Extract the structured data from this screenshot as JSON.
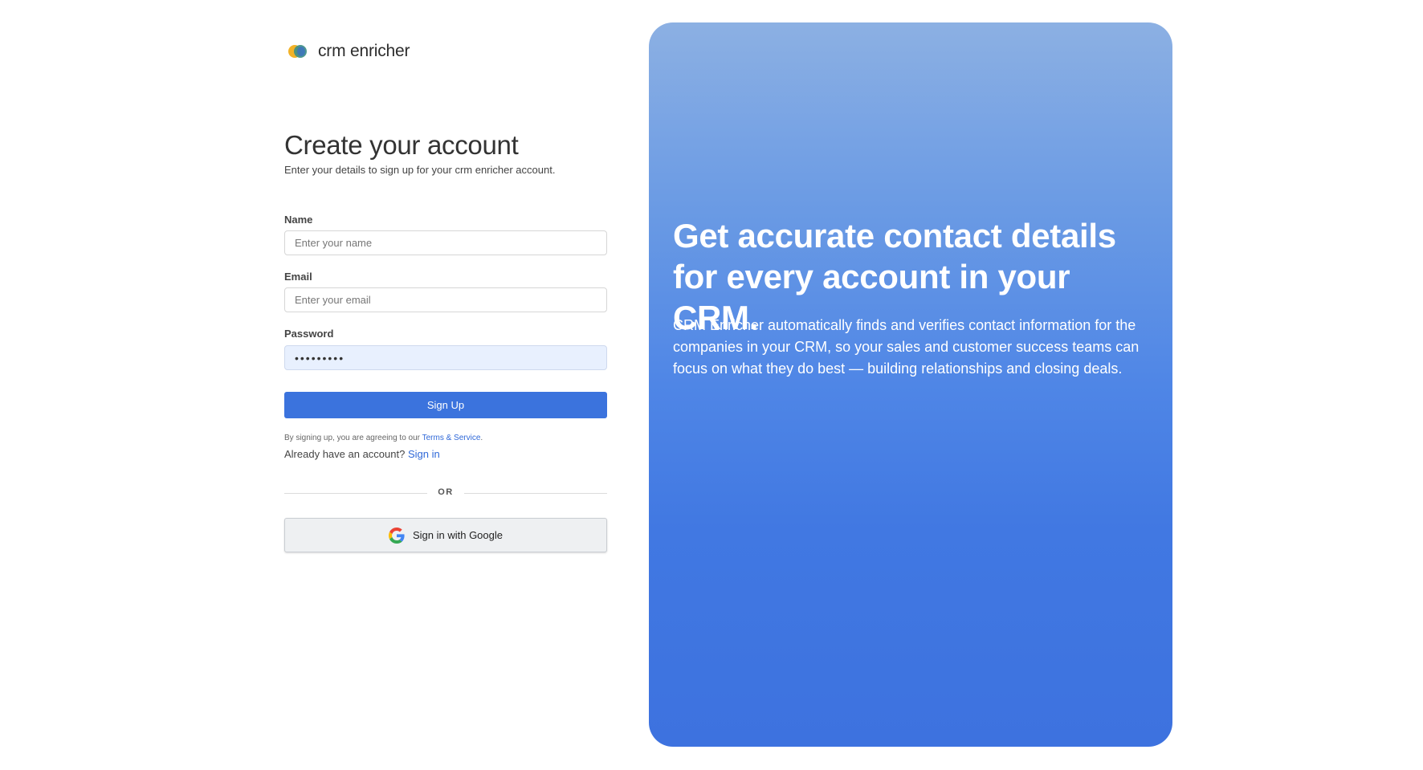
{
  "brand": {
    "name": "crm enricher"
  },
  "form": {
    "title": "Create your account",
    "subtitle": "Enter your details to sign up for your crm enricher account.",
    "name": {
      "label": "Name",
      "placeholder": "Enter your name",
      "value": ""
    },
    "email": {
      "label": "Email",
      "placeholder": "Enter your email",
      "value": ""
    },
    "password": {
      "label": "Password",
      "value": "•••••••••"
    },
    "signup_label": "Sign Up",
    "terms_prefix": "By signing up, you are agreeing to our ",
    "terms_link": "Terms & Service",
    "terms_suffix": ".",
    "already_prefix": "Already have an account? ",
    "signin_link": "Sign in",
    "or_text": "OR",
    "google_label": "Sign in with Google"
  },
  "hero": {
    "title": "Get accurate contact details for every account in your CRM.",
    "body": "CRM Enricher automatically finds and verifies contact information for the companies in your CRM, so your sales and customer success teams can focus on what they do best — building relationships and closing deals."
  },
  "colors": {
    "primary": "#3b73dd",
    "link": "#2f68d8",
    "hero_top": "#8cb0e3",
    "hero_bottom": "#3d72df",
    "autofill_bg": "#e8f0fe"
  },
  "icons": {
    "logo": "crm-enricher-logo",
    "google": "google-g-icon"
  }
}
